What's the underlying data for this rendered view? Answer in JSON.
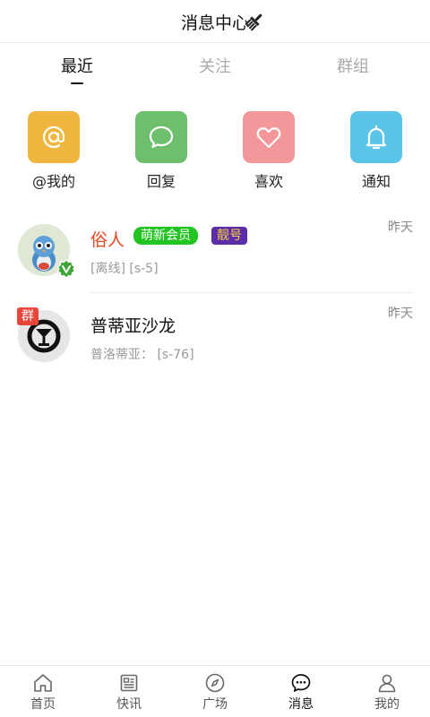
{
  "header": {
    "title": "消息中心",
    "action_icon": "clean-broom-icon"
  },
  "tabs": [
    {
      "label": "最近",
      "active": true
    },
    {
      "label": "关注",
      "active": false
    },
    {
      "label": "群组",
      "active": false
    }
  ],
  "quick_actions": [
    {
      "label": "@我的",
      "icon": "at-icon",
      "color": "#F0B63F"
    },
    {
      "label": "回复",
      "icon": "comment-bubble-icon",
      "color": "#6DBF6E"
    },
    {
      "label": "喜欢",
      "icon": "heart-icon",
      "color": "#F3979B"
    },
    {
      "label": "通知",
      "icon": "bell-icon",
      "color": "#5BC5E8"
    }
  ],
  "messages": [
    {
      "name": "俗人",
      "name_color": "#E8461F",
      "badges": [
        {
          "text": "萌新会员",
          "color": "#22C421"
        },
        {
          "text": "靓号",
          "color": "#5B2DA8",
          "text_color": "#F7D43A"
        }
      ],
      "subtitle": "[离线] [s-5]",
      "time": "昨天",
      "verified": true
    },
    {
      "name": "普蒂亚沙龙",
      "name_color": "#111111",
      "group_tag": "群",
      "subtitle": "普洛蒂亚： [s-76]",
      "time": "昨天"
    }
  ],
  "tabbar": [
    {
      "label": "首页",
      "icon": "home-icon",
      "active": false
    },
    {
      "label": "快讯",
      "icon": "news-icon",
      "active": false
    },
    {
      "label": "广场",
      "icon": "compass-icon",
      "active": false
    },
    {
      "label": "消息",
      "icon": "message-icon",
      "active": true
    },
    {
      "label": "我的",
      "icon": "user-icon",
      "active": false
    }
  ]
}
